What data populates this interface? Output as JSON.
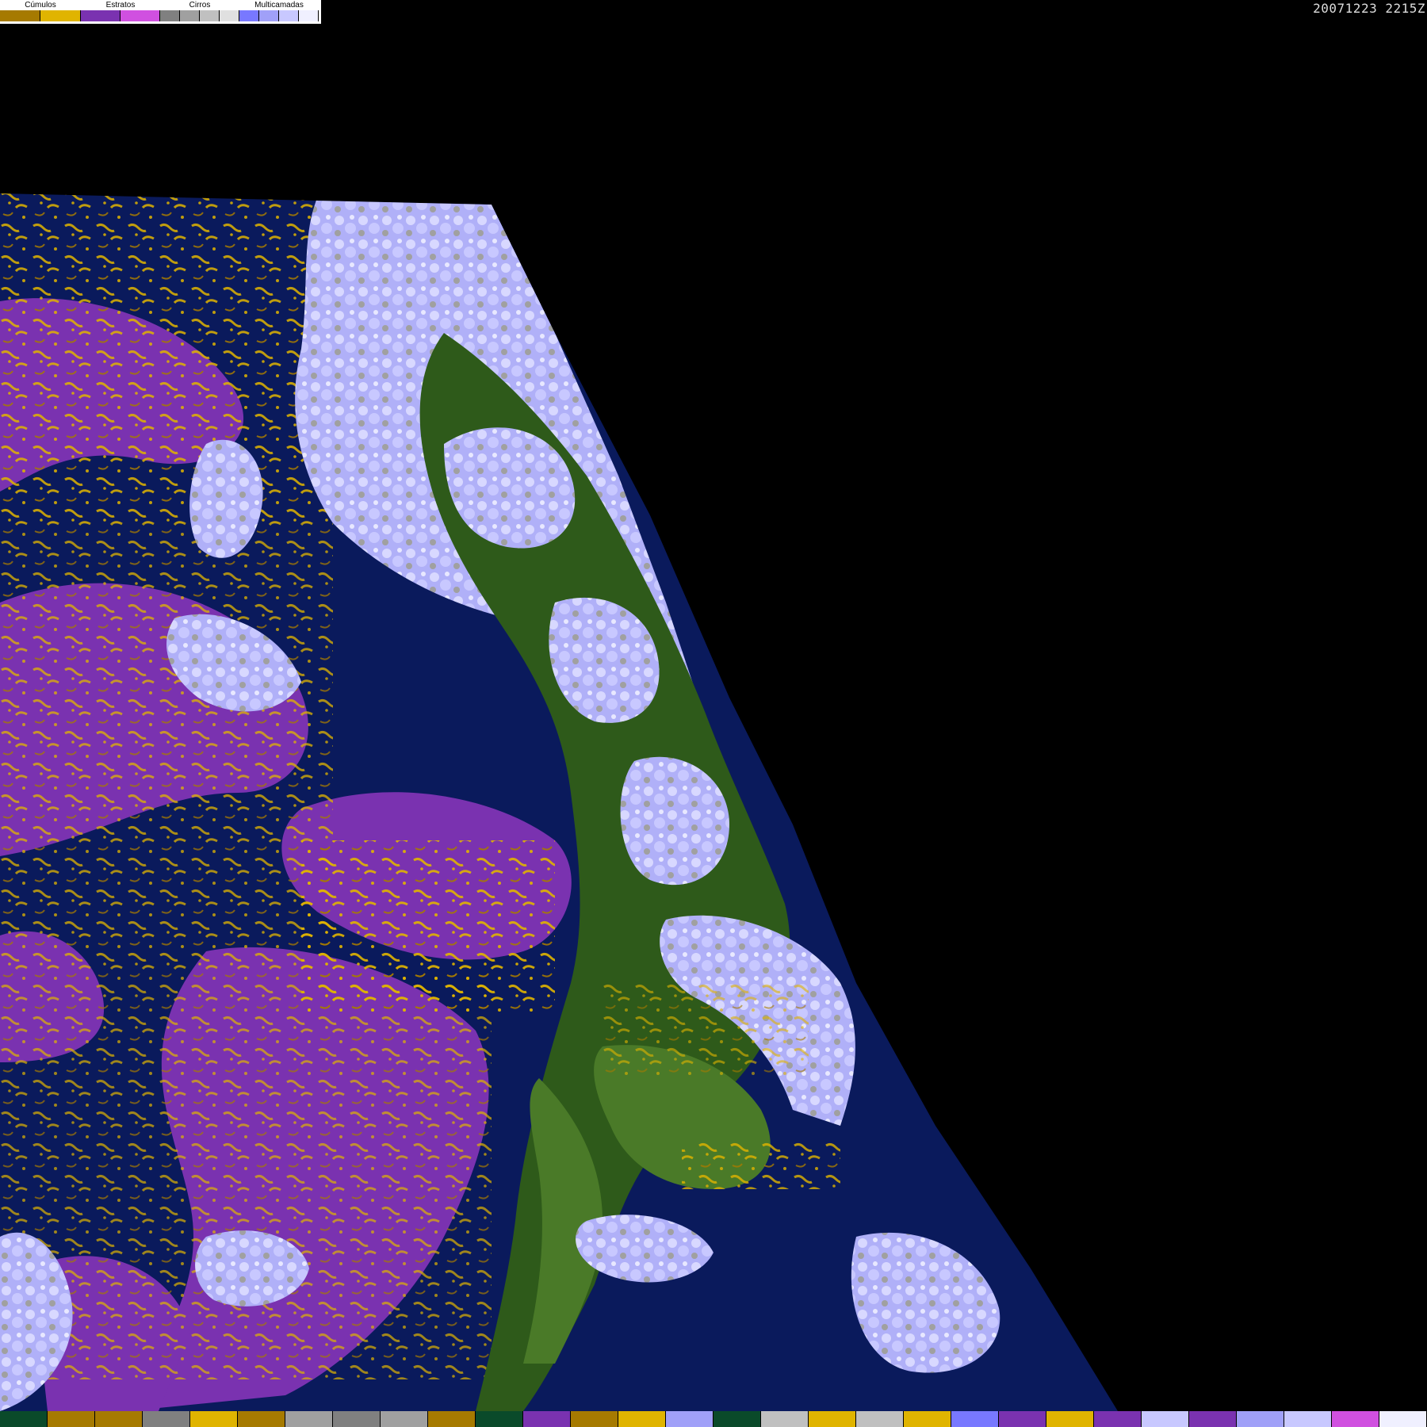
{
  "legend": {
    "groups": [
      {
        "label": "Cúmulos",
        "colors": [
          "#a67a00",
          "#e0b400"
        ]
      },
      {
        "label": "Estratos",
        "colors": [
          "#7a32b0",
          "#d050e0"
        ]
      },
      {
        "label": "Cirros",
        "colors": [
          "#808080",
          "#a0a0a0",
          "#c0c0c0",
          "#e0e0e0"
        ]
      },
      {
        "label": "Multicamadas",
        "colors": [
          "#7878ff",
          "#a0a0f8",
          "#c8c8ff",
          "#f0f0ff"
        ]
      }
    ]
  },
  "timestamp": "20071223 2215Z",
  "palette": {
    "ocean": "#0a1a5c",
    "stratus": "#7a32b0",
    "cumulus": "#e0b400",
    "land_green": "#2e5a1a",
    "land_light": "#4a7a28",
    "multilayer": "#b0b0f8",
    "cirrus": "#c0c0c0",
    "space": "#000000"
  },
  "bottom_strip": [
    "#0a4a2a",
    "#a67a00",
    "#a67a00",
    "#808080",
    "#e0b400",
    "#a67a00",
    "#a0a0a0",
    "#808080",
    "#a0a0a0",
    "#a67a00",
    "#0a4a2a",
    "#7a32b0",
    "#a67a00",
    "#e0b400",
    "#a0a0f8",
    "#0a4a2a",
    "#c0c0c0",
    "#e0b400",
    "#c0c0c0",
    "#e0b400",
    "#7878ff",
    "#7a32b0",
    "#e0b400",
    "#7a32b0",
    "#c8c8ff",
    "#7a32b0",
    "#a0a0f8",
    "#c8c8ff",
    "#d050e0",
    "#f0f0ff"
  ]
}
